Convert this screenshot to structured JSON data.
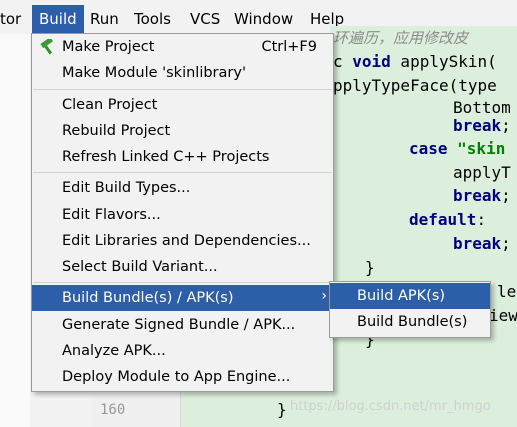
{
  "menubar": {
    "items": [
      "tor",
      "Build",
      "Run",
      "Tools",
      "VCS",
      "Window",
      "Help"
    ]
  },
  "editor": {
    "comment": "环遍历，应用修改皮",
    "lines": [
      {
        "pre": "c ",
        "kw": "void",
        "post": " applySkin("
      },
      {
        "text": "pplyTypeFace(type"
      },
      {
        "text": "Bottom"
      },
      {
        "kw": "break",
        "post": ";"
      },
      {
        "kw": "case",
        "str": " \"skin"
      },
      {
        "text": "applyT"
      },
      {
        "kw": "break",
        "post": ";"
      },
      {
        "kw": "default",
        "post": ":"
      },
      {
        "kw": "break",
        "post": ";"
      },
      {
        "text": "}"
      },
      {
        "text": "le"
      },
      {
        "text": "iew"
      },
      {
        "text": "}"
      },
      {
        "text": "}"
      }
    ],
    "line_numbers": [
      "160"
    ]
  },
  "build_menu": {
    "items": [
      {
        "label": "Make Project",
        "shortcut": "Ctrl+F9",
        "icon": "hammer-icon"
      },
      {
        "label": "Make Module 'skinlibrary'"
      },
      {
        "label": "Clean Project"
      },
      {
        "label": "Rebuild Project"
      },
      {
        "label": "Refresh Linked C++ Projects"
      },
      {
        "label": "Edit Build Types..."
      },
      {
        "label": "Edit Flavors..."
      },
      {
        "label": "Edit Libraries and Dependencies..."
      },
      {
        "label": "Select Build Variant..."
      },
      {
        "label": "Build Bundle(s) / APK(s)",
        "arrow": "›"
      },
      {
        "label": "Generate Signed Bundle / APK..."
      },
      {
        "label": "Analyze APK..."
      },
      {
        "label": "Deploy Module to App Engine..."
      }
    ]
  },
  "submenu": {
    "items": [
      {
        "label": "Build APK(s)"
      },
      {
        "label": "Build Bundle(s)"
      }
    ]
  },
  "watermark": "https://blog.csdn.net/mr_hmgo",
  "colors": {
    "highlight": "#2d5ea9",
    "editor_bg": "#dcefdc",
    "keyword": "#000080",
    "string": "#008000"
  }
}
